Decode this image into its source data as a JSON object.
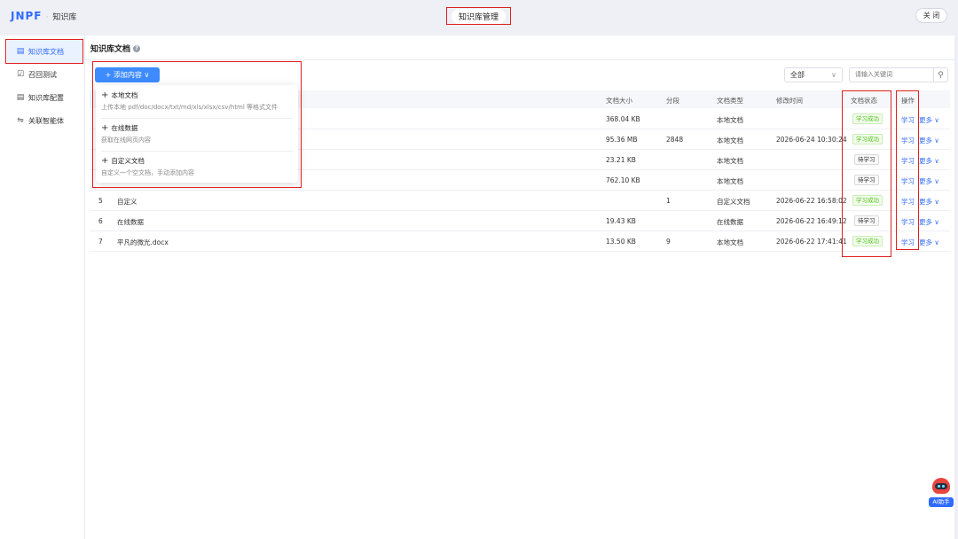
{
  "header": {
    "logo": "JNPF",
    "logo_sep": "·",
    "logo_sub": "知识库",
    "title": "知识库管理",
    "close_label": "关 闭"
  },
  "sidebar": {
    "items": [
      {
        "label": "知识库文档",
        "icon": "document-icon",
        "active": true
      },
      {
        "label": "召回测试",
        "icon": "checkbox-icon",
        "active": false
      },
      {
        "label": "知识库配置",
        "icon": "database-icon",
        "active": false
      },
      {
        "label": "关联智能体",
        "icon": "link-icon",
        "active": false
      }
    ]
  },
  "main": {
    "title": "知识库文档",
    "add_button": "+ 添加内容 ∨",
    "filter_value": "全部",
    "search_placeholder": "请输入关键词",
    "dropdown": [
      {
        "title": "本地文档",
        "desc": "上传本地 pdf/doc/docx/txt/md/xls/xlsx/csv/html 等格式文件"
      },
      {
        "title": "在线数据",
        "desc": "获取在线网页内容"
      },
      {
        "title": "自定义文档",
        "desc": "自定义一个空文档，手动添加内容"
      }
    ],
    "columns": {
      "size": "文档大小",
      "segments": "分段",
      "type": "文档类型",
      "modified": "修改时间",
      "status": "文档状态",
      "ops": "操作"
    },
    "rows": [
      {
        "index": "",
        "name": "",
        "size": "368.04 KB",
        "segments": "",
        "type": "本地文档",
        "modified": "",
        "status": "学习成功",
        "status_kind": "ok"
      },
      {
        "index": "",
        "name": "",
        "size": "95.36 MB",
        "segments": "2848",
        "type": "本地文档",
        "modified": "2026-06-24 10:30:24",
        "status": "学习成功",
        "status_kind": "ok"
      },
      {
        "index": "",
        "name": "",
        "size": "23.21 KB",
        "segments": "",
        "type": "本地文档",
        "modified": "",
        "status": "待学习",
        "status_kind": "wait"
      },
      {
        "index": "",
        "name": "",
        "size": "762.10 KB",
        "segments": "",
        "type": "本地文档",
        "modified": "",
        "status": "待学习",
        "status_kind": "wait"
      },
      {
        "index": "5",
        "name": "自定义",
        "size": "",
        "segments": "1",
        "type": "自定义文档",
        "modified": "2026-06-22 16:58:02",
        "status": "学习成功",
        "status_kind": "ok"
      },
      {
        "index": "6",
        "name": "在线数据",
        "size": "19.43 KB",
        "segments": "",
        "type": "在线数据",
        "modified": "2026-06-22 16:49:12",
        "status": "待学习",
        "status_kind": "wait"
      },
      {
        "index": "7",
        "name": "平凡的微光.docx",
        "size": "13.50 KB",
        "segments": "9",
        "type": "本地文档",
        "modified": "2026-06-22 17:41:41",
        "status": "学习成功",
        "status_kind": "ok"
      }
    ],
    "op_learn": "学习",
    "op_more": "更多 ∨"
  },
  "assistant": {
    "label": "AI助手"
  },
  "colors": {
    "accent": "#2f6bff",
    "success": "#52c41a",
    "highlight": "#e02020"
  }
}
